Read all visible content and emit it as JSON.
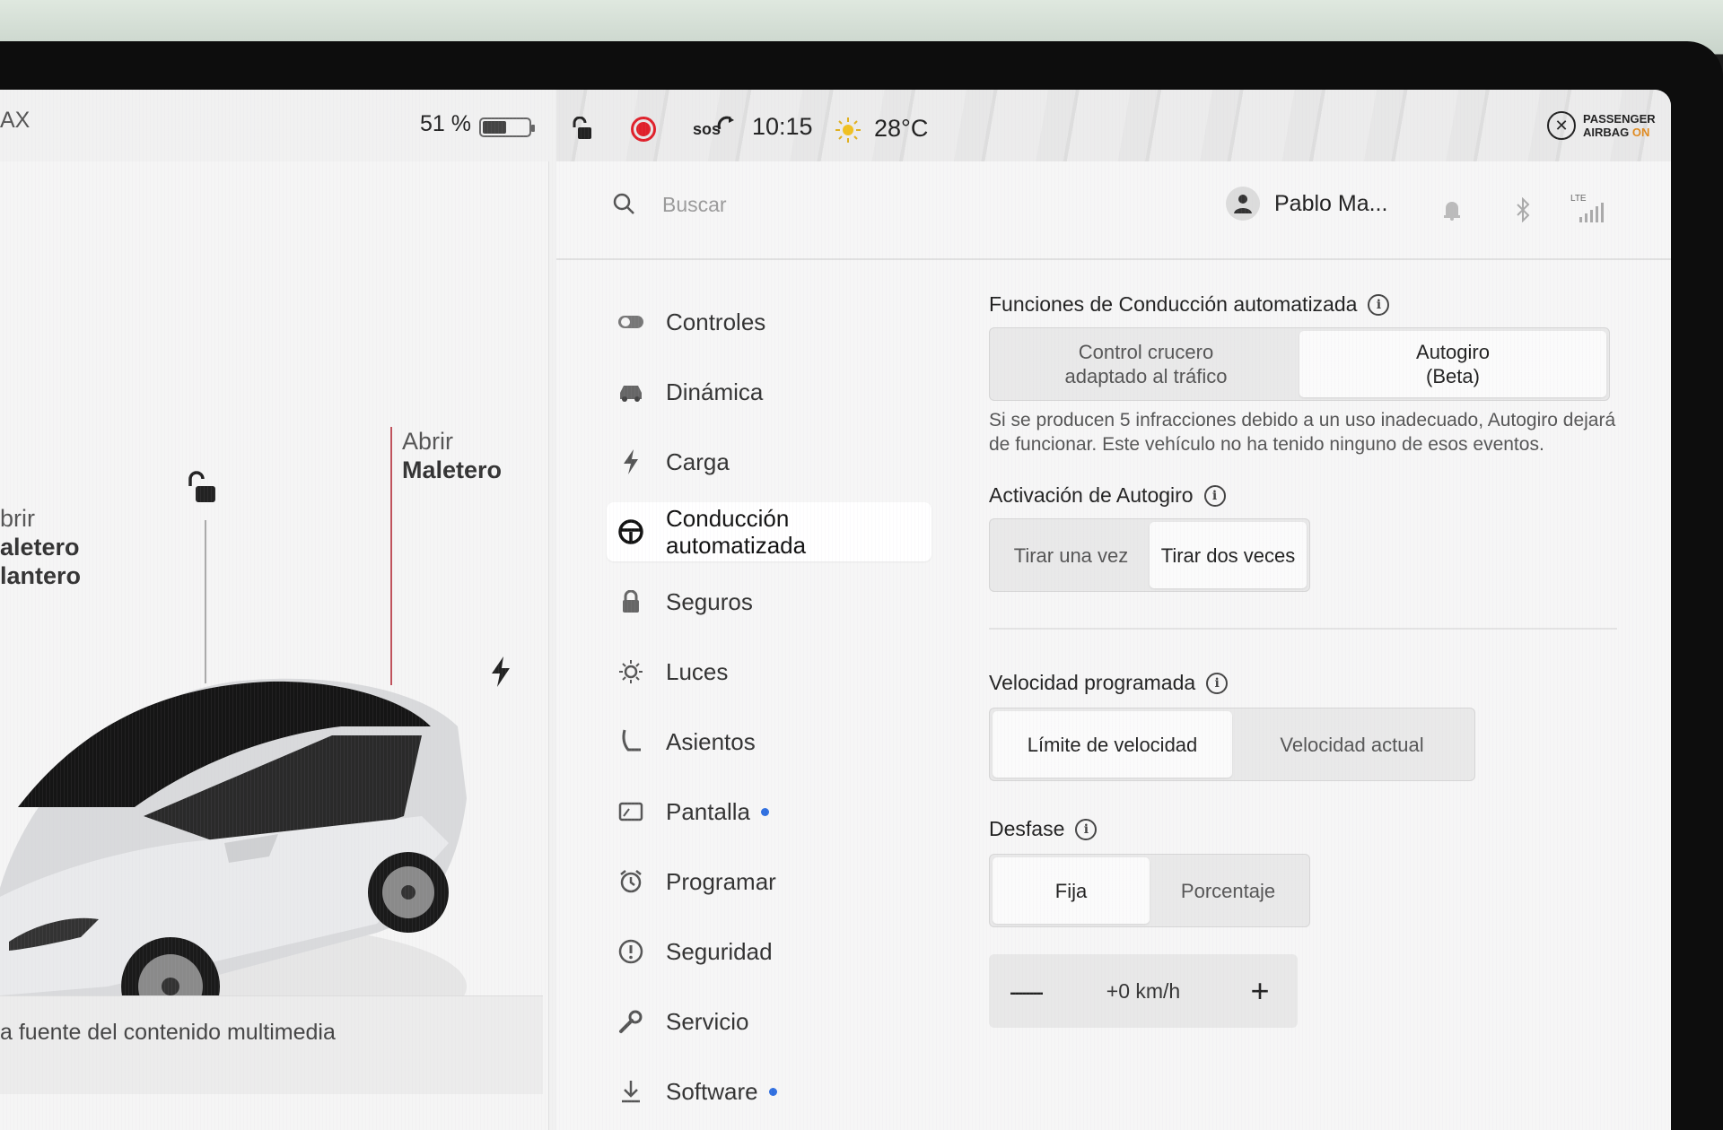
{
  "status_bar": {
    "range_fragment": "AX",
    "battery_percent": "51 %",
    "battery_level": 0.51,
    "sos": "sos",
    "time": "10:15",
    "temperature": "28°C",
    "airbag_line1": "PASSENGER",
    "airbag_line2_prefix": "AIRBAG",
    "airbag_line2_state": "ON",
    "airbag_state_color": "#e08a1e",
    "record_color": "#e0202a"
  },
  "car_panel": {
    "front_trunk_line1": "brir",
    "front_trunk_line2": "aletero",
    "front_trunk_line3": "lantero",
    "rear_trunk_line1": "Abrir",
    "rear_trunk_line2": "Maletero",
    "media_source_text": "a fuente del contenido multimedia"
  },
  "header": {
    "search_placeholder": "Buscar",
    "user_name": "Pablo Ma...",
    "signal_label": "LTE"
  },
  "nav": {
    "items": [
      {
        "label": "Controles",
        "icon": "toggle-icon"
      },
      {
        "label": "Dinámica",
        "icon": "car-icon"
      },
      {
        "label": "Carga",
        "icon": "lightning-icon"
      },
      {
        "label_line1": "Conducción",
        "label_line2": "automatizada",
        "icon": "steering-wheel-icon",
        "active": true
      },
      {
        "label": "Seguros",
        "icon": "lock-icon"
      },
      {
        "label": "Luces",
        "icon": "light-icon"
      },
      {
        "label": "Asientos",
        "icon": "seat-icon"
      },
      {
        "label": "Pantalla",
        "icon": "display-icon",
        "badge": true
      },
      {
        "label": "Programar",
        "icon": "alarm-clock-icon"
      },
      {
        "label": "Seguridad",
        "icon": "alert-icon"
      },
      {
        "label": "Servicio",
        "icon": "wrench-icon"
      },
      {
        "label": "Software",
        "icon": "download-icon",
        "badge": true
      }
    ],
    "badge_color": "#2f6fe0"
  },
  "autopilot": {
    "features_title": "Funciones de Conducción automatizada",
    "features_options": [
      {
        "line1": "Control crucero",
        "line2": "adaptado al tráfico",
        "selected": false
      },
      {
        "line1": "Autogiro",
        "line2": "(Beta)",
        "selected": true
      }
    ],
    "strike_description": "Si se producen 5 infracciones debido a un uso inadecuado, Autogiro dejará de funcionar. Este vehículo no ha tenido ninguno de esos eventos.",
    "activation_title": "Activación de Autogiro",
    "activation_options": [
      {
        "label": "Tirar una vez",
        "selected": false
      },
      {
        "label": "Tirar dos veces",
        "selected": true
      }
    ],
    "set_speed_title": "Velocidad programada",
    "set_speed_options": [
      {
        "label": "Límite de velocidad",
        "selected": true
      },
      {
        "label": "Velocidad actual",
        "selected": false
      }
    ],
    "offset_title": "Desfase",
    "offset_options": [
      {
        "label": "Fija",
        "selected": true
      },
      {
        "label": "Porcentaje",
        "selected": false
      }
    ],
    "offset_minus": "—",
    "offset_value": "+0 km/h",
    "offset_plus": "+"
  }
}
